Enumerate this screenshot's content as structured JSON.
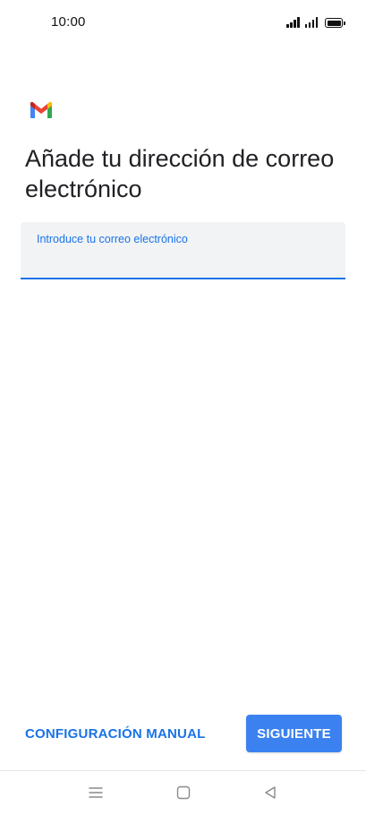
{
  "status_bar": {
    "time": "10:00",
    "icons": [
      "signal-icon",
      "signal-icon",
      "battery-icon"
    ]
  },
  "app": {
    "logo_icon": "gmail-logo-icon",
    "colors": {
      "accent": "#1a73e8",
      "button": "#3b82f0",
      "field_bg": "#f1f3f4",
      "logo_red": "#ea4335",
      "logo_blue": "#4285f4",
      "logo_green": "#34a853",
      "logo_yellow": "#fbbc04"
    }
  },
  "main": {
    "title": "Añade tu dirección de correo electrónico",
    "email_field": {
      "label": "Introduce tu correo electrónico",
      "value": ""
    }
  },
  "actions": {
    "manual_config_label": "CONFIGURACIÓN MANUAL",
    "next_label": "SIGUIENTE"
  },
  "nav_bar": {
    "icons": [
      "menu-icon",
      "home-icon",
      "back-icon"
    ]
  }
}
